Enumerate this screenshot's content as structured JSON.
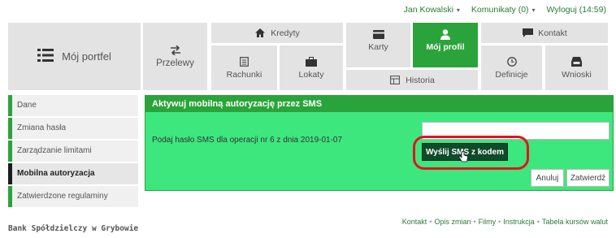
{
  "topbar": {
    "user": "Jan Kowalski",
    "messages": "Komunikaty (0)",
    "logout": "Wyloguj (14:59)"
  },
  "tiles": {
    "portfolio": "Mój portfel",
    "transfers": "Przelewy",
    "credits": "Kredyty",
    "accounts": "Rachunki",
    "deposits": "Lokaty",
    "cards": "Karty",
    "history": "Historia",
    "profile": "Mój profil",
    "contact": "Kontakt",
    "definitions": "Definicje",
    "applications": "Wnioski"
  },
  "sidebar": {
    "items": [
      {
        "label": "Dane"
      },
      {
        "label": "Zmiana hasła"
      },
      {
        "label": "Zarządzanie limitami"
      },
      {
        "label": "Mobilna autoryzacja"
      },
      {
        "label": "Zatwierdzone regulaminy"
      }
    ]
  },
  "panel": {
    "title": "Aktywuj mobilną autoryzację przez SMS",
    "prompt": "Podaj hasło SMS dla operacji nr 6 z dnia 2019-01-07",
    "sms_value": "",
    "send_label": "Wyślij SMS z kodem",
    "cancel_label": "Anuluj",
    "confirm_label": "Zatwierdź"
  },
  "footer": {
    "bank": "Bank Spółdzielczy w Grybowie",
    "links": [
      "Kontakt",
      "Opis zmian",
      "Filmy",
      "Instrukcja",
      "Tabela kursów walut"
    ]
  },
  "colors": {
    "accent": "#2aa43a",
    "panel_bg": "#3ee67e",
    "button_dark": "#0f4b2a",
    "highlight": "#e0141e"
  }
}
